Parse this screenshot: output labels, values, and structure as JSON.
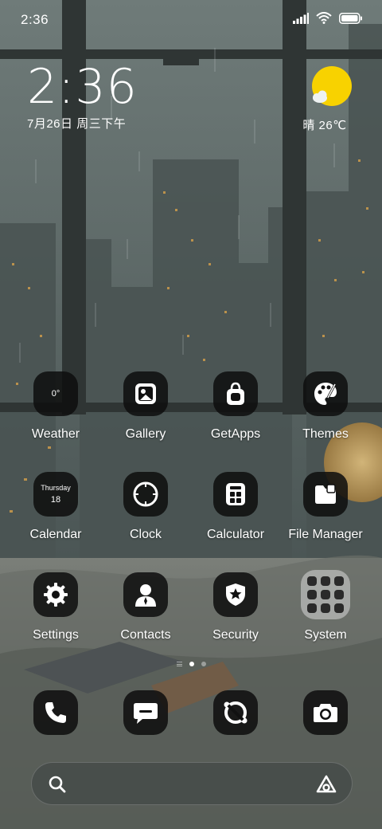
{
  "status_bar": {
    "time": "2:36",
    "icons": [
      "signal-icon",
      "wifi-icon",
      "battery-icon"
    ]
  },
  "clock_widget": {
    "time": "2:36",
    "date": "7月26日 周三下午"
  },
  "weather_widget": {
    "icon": "sunny-partly-cloudy-icon",
    "text": "晴 26℃"
  },
  "apps": {
    "row1": [
      {
        "label": "Weather",
        "icon": "weather-icon",
        "tile_text": "0°"
      },
      {
        "label": "Gallery",
        "icon": "gallery-icon"
      },
      {
        "label": "GetApps",
        "icon": "getapps-icon"
      },
      {
        "label": "Themes",
        "icon": "themes-icon"
      }
    ],
    "row2": [
      {
        "label": "Calendar",
        "icon": "calendar-icon",
        "tile_day": "Thursday",
        "tile_date": "18"
      },
      {
        "label": "Clock",
        "icon": "clock-icon"
      },
      {
        "label": "Calculator",
        "icon": "calculator-icon"
      },
      {
        "label": "File Manager",
        "icon": "file-manager-icon"
      }
    ],
    "row3": [
      {
        "label": "Settings",
        "icon": "settings-icon"
      },
      {
        "label": "Contacts",
        "icon": "contacts-icon"
      },
      {
        "label": "Security",
        "icon": "security-icon"
      },
      {
        "label": "System",
        "icon": "system-folder-icon"
      }
    ]
  },
  "page_indicator": {
    "pages": 2,
    "current": 1
  },
  "dock": [
    {
      "icon": "phone-icon"
    },
    {
      "icon": "messages-icon"
    },
    {
      "icon": "browser-icon"
    },
    {
      "icon": "camera-icon"
    }
  ],
  "search_bar": {
    "placeholder": "",
    "left_icon": "search-icon",
    "right_icon": "assistant-icon"
  },
  "colors": {
    "sun": "#f8d200",
    "tile": "#0e0e0e",
    "text": "#ffffff"
  }
}
